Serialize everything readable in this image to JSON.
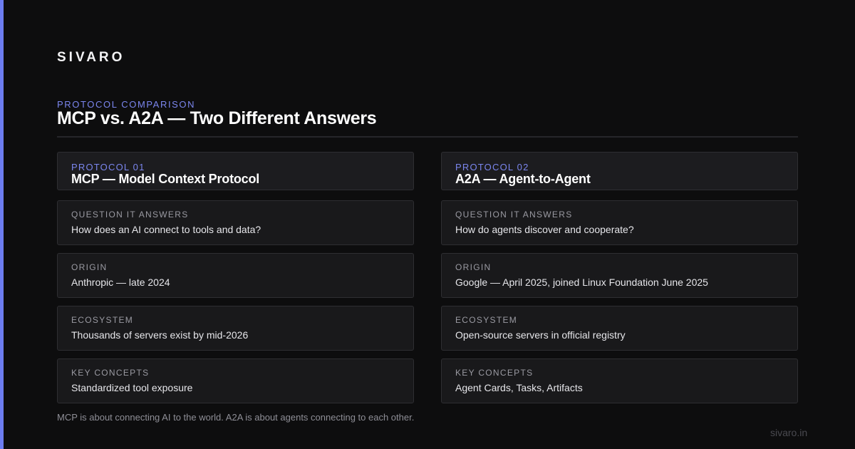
{
  "brand": "SIVARO",
  "header": {
    "eyebrow": "PROTOCOL COMPARISON",
    "title": "MCP vs. A2A — Two Different Answers"
  },
  "protocols": [
    {
      "label": "PROTOCOL 01",
      "name": "MCP — Model Context Protocol",
      "rows": [
        {
          "label": "QUESTION IT ANSWERS",
          "value": "How does an AI connect to tools and data?"
        },
        {
          "label": "ORIGIN",
          "value": "Anthropic — late 2024"
        },
        {
          "label": "ECOSYSTEM",
          "value": "Thousands of servers exist by mid-2026"
        },
        {
          "label": "KEY CONCEPTS",
          "value": "Standardized tool exposure"
        }
      ]
    },
    {
      "label": "PROTOCOL 02",
      "name": "A2A — Agent-to-Agent",
      "rows": [
        {
          "label": "QUESTION IT ANSWERS",
          "value": "How do agents discover and cooperate?"
        },
        {
          "label": "ORIGIN",
          "value": "Google — April 2025, joined Linux Foundation June 2025"
        },
        {
          "label": "ECOSYSTEM",
          "value": "Open-source servers in official registry"
        },
        {
          "label": "KEY CONCEPTS",
          "value": "Agent Cards, Tasks, Artifacts"
        }
      ]
    }
  ],
  "footnote": "MCP is about connecting AI to the world. A2A is about agents connecting to each other.",
  "site": "sivaro.in",
  "colors": {
    "background": "#0d0d0e",
    "accent": "#6c7cf0",
    "card": "#19191b",
    "card_border": "#2e2e32"
  }
}
